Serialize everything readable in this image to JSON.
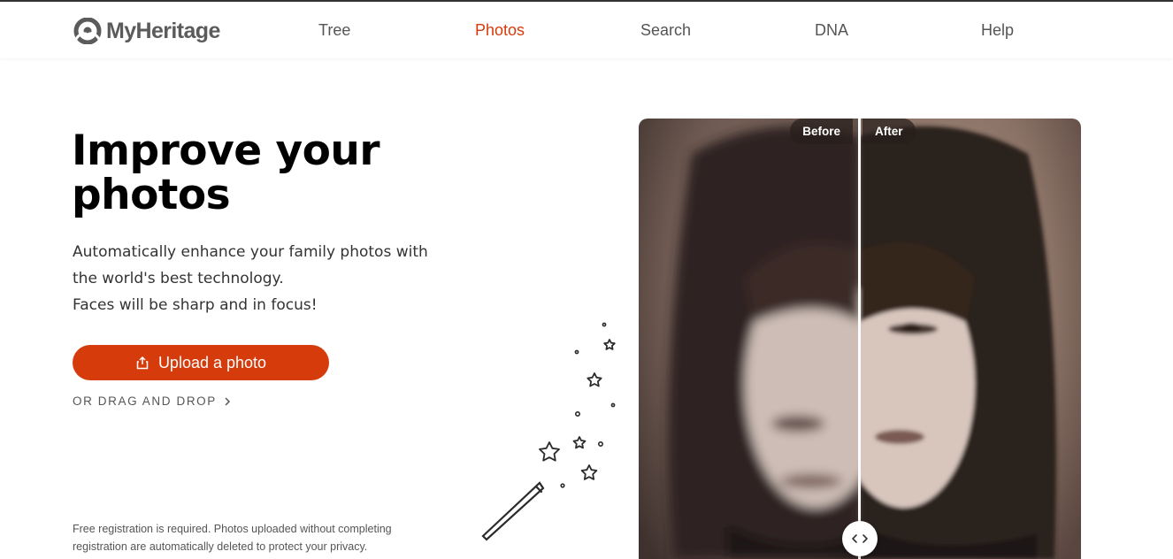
{
  "header": {
    "logo_text": "MyHeritage",
    "nav": [
      {
        "label": "Tree",
        "active": false
      },
      {
        "label": "Photos",
        "active": true
      },
      {
        "label": "Search",
        "active": false
      },
      {
        "label": "DNA",
        "active": false
      },
      {
        "label": "Help",
        "active": false
      }
    ]
  },
  "hero": {
    "title": "Improve your photos",
    "subtitle_lines": [
      "Automatically enhance your family photos with",
      "the world's best technology.",
      "Faces will be sharp and in focus!"
    ],
    "upload_label": "Upload a photo",
    "upload_icon": "upload-icon",
    "drag_label": "OR DRAG AND DROP",
    "footnote": "Free registration is required. Photos uploaded without completing registration are automatically deleted to protect your privacy."
  },
  "comparison": {
    "before_label": "Before",
    "after_label": "After",
    "slider_position": 0.5,
    "handle_icon": "left-right-arrows-icon"
  },
  "colors": {
    "accent": "#d63b0b",
    "text_dark": "#000000",
    "text_muted": "#555555"
  }
}
